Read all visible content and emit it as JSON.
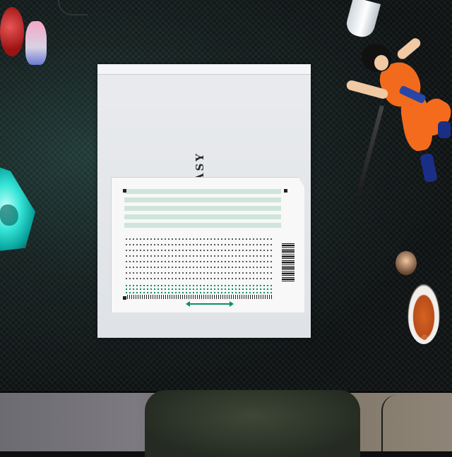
{
  "scene": {
    "clipboard_brand": "ASY"
  }
}
